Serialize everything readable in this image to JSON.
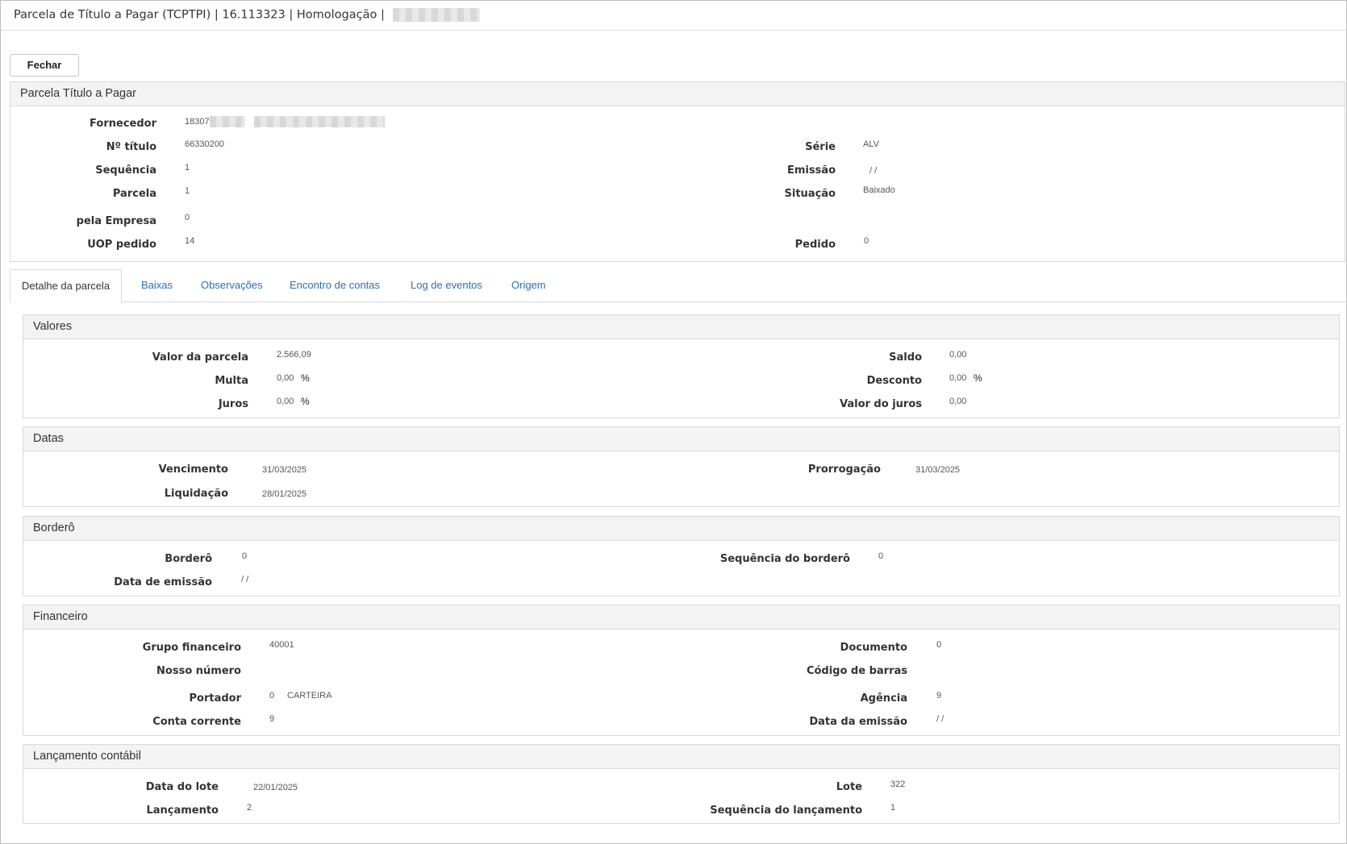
{
  "window": {
    "title": "Parcela de Título a Pagar (TCPTPI) | 16.113323 | Homologação |"
  },
  "toolbar": {
    "close_label": "Fechar"
  },
  "header_panel": {
    "title": "Parcela Título a Pagar",
    "fornecedor_label": "Fornecedor",
    "fornecedor_value": "18307",
    "titulo_label": "Nº título",
    "titulo_value": "66330200",
    "serie_label": "Série",
    "serie_value": "ALV",
    "sequencia_label": "Sequência",
    "sequencia_value": "1",
    "emissao_label": "Emissão",
    "emissao_value": "/ /",
    "parcela_label": "Parcela",
    "parcela_value": "1",
    "situacao_label": "Situação",
    "situacao_value": "Baixado",
    "empresa_label": "pela Empresa",
    "empresa_value": "0",
    "uop_label": "UOP pedido",
    "uop_value": "14",
    "pedido_label": "Pedido",
    "pedido_value": "0"
  },
  "tabs": [
    {
      "label": "Detalhe da parcela",
      "active": true
    },
    {
      "label": "Baixas",
      "active": false
    },
    {
      "label": "Observações",
      "active": false
    },
    {
      "label": "Encontro de contas",
      "active": false
    },
    {
      "label": "Log de eventos",
      "active": false
    },
    {
      "label": "Origem",
      "active": false
    }
  ],
  "valores": {
    "title": "Valores",
    "valor_parcela_label": "Valor da parcela",
    "valor_parcela_value": "2.566,09",
    "saldo_label": "Saldo",
    "saldo_value": "0,00",
    "multa_label": "Multa",
    "multa_value": "0,00",
    "desconto_label": "Desconto",
    "desconto_value": "0,00",
    "juros_label": "Juros",
    "juros_value": "0,00",
    "valor_juros_label": "Valor do juros",
    "valor_juros_value": "0,00",
    "percent_symbol": "%"
  },
  "datas": {
    "title": "Datas",
    "vencimento_label": "Vencimento",
    "vencimento_value": "31/03/2025",
    "prorrogacao_label": "Prorrogação",
    "prorrogacao_value": "31/03/2025",
    "liquidacao_label": "Liquidação",
    "liquidacao_value": "28/01/2025"
  },
  "bordero": {
    "title": "Borderô",
    "bordero_label": "Borderô",
    "bordero_value": "0",
    "seq_bordero_label": "Sequência do borderô",
    "seq_bordero_value": "0",
    "data_emissao_label": "Data de emissão",
    "data_emissao_value": "/ /"
  },
  "financeiro": {
    "title": "Financeiro",
    "grupo_label": "Grupo financeiro",
    "grupo_value": "40001",
    "documento_label": "Documento",
    "documento_value": "0",
    "nosso_numero_label": "Nosso número",
    "codigo_barras_label": "Código de barras",
    "portador_label": "Portador",
    "portador_value": "0",
    "portador_name": "CARTEIRA",
    "agencia_label": "Agência",
    "agencia_value": "9",
    "conta_label": "Conta corrente",
    "conta_value": "9",
    "data_emissao_label": "Data da emissão",
    "data_emissao_value": "/ /"
  },
  "lancamento": {
    "title": "Lançamento contábil",
    "data_lote_label": "Data do lote",
    "data_lote_value": "22/01/2025",
    "lote_label": "Lote",
    "lote_value": "322",
    "lancamento_label": "Lançamento",
    "lancamento_value": "2",
    "seq_lancamento_label": "Sequência do lançamento",
    "seq_lancamento_value": "1"
  }
}
